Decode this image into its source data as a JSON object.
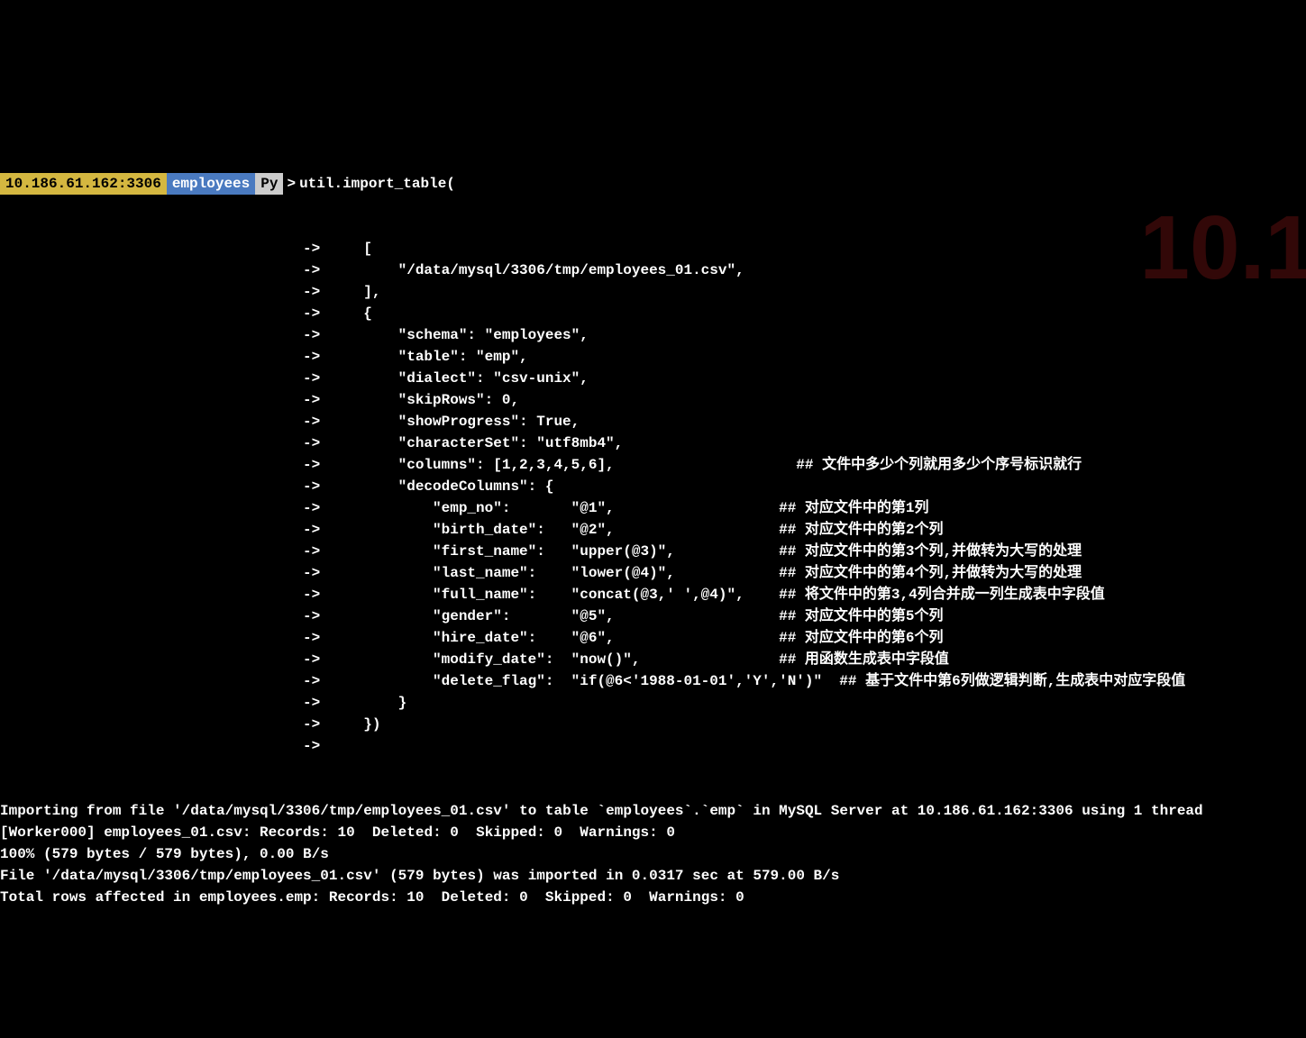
{
  "prompt": {
    "host": "10.186.61.162:3306",
    "database": "employees",
    "mode": "Py",
    "gt": ">",
    "first_cmd": "util.import_table("
  },
  "lines": [
    "->     [",
    "->         \"/data/mysql/3306/tmp/employees_01.csv\",",
    "->     ],",
    "->     {",
    "->         \"schema\": \"employees\",",
    "->         \"table\": \"emp\",",
    "->         \"dialect\": \"csv-unix\",",
    "->         \"skipRows\": 0,",
    "->         \"showProgress\": True,",
    "->         \"characterSet\": \"utf8mb4\",",
    "->         \"columns\": [1,2,3,4,5,6],                     ## 文件中多少个列就用多少个序号标识就行",
    "->         \"decodeColumns\": {",
    "->             \"emp_no\":       \"@1\",                   ## 对应文件中的第1列",
    "->             \"birth_date\":   \"@2\",                   ## 对应文件中的第2个列",
    "->             \"first_name\":   \"upper(@3)\",            ## 对应文件中的第3个列,并做转为大写的处理",
    "->             \"last_name\":    \"lower(@4)\",            ## 对应文件中的第4个列,并做转为大写的处理",
    "->             \"full_name\":    \"concat(@3,' ',@4)\",    ## 将文件中的第3,4列合并成一列生成表中字段值",
    "->             \"gender\":       \"@5\",                   ## 对应文件中的第5个列",
    "->             \"hire_date\":    \"@6\",                   ## 对应文件中的第6个列",
    "->             \"modify_date\":  \"now()\",                ## 用函数生成表中字段值",
    "->             \"delete_flag\":  \"if(@6<'1988-01-01','Y','N')\"  ## 基于文件中第6列做逻辑判断,生成表中对应字段值",
    "->         }",
    "->     })",
    "->"
  ],
  "output": [
    "Importing from file '/data/mysql/3306/tmp/employees_01.csv' to table `employees`.`emp` in MySQL Server at 10.186.61.162:3306 using 1 thread",
    "[Worker000] employees_01.csv: Records: 10  Deleted: 0  Skipped: 0  Warnings: 0",
    "100% (579 bytes / 579 bytes), 0.00 B/s",
    "File '/data/mysql/3306/tmp/employees_01.csv' (579 bytes) was imported in 0.0317 sec at 579.00 B/s",
    "Total rows affected in employees.emp: Records: 10  Deleted: 0  Skipped: 0  Warnings: 0"
  ],
  "watermark": "10.1"
}
